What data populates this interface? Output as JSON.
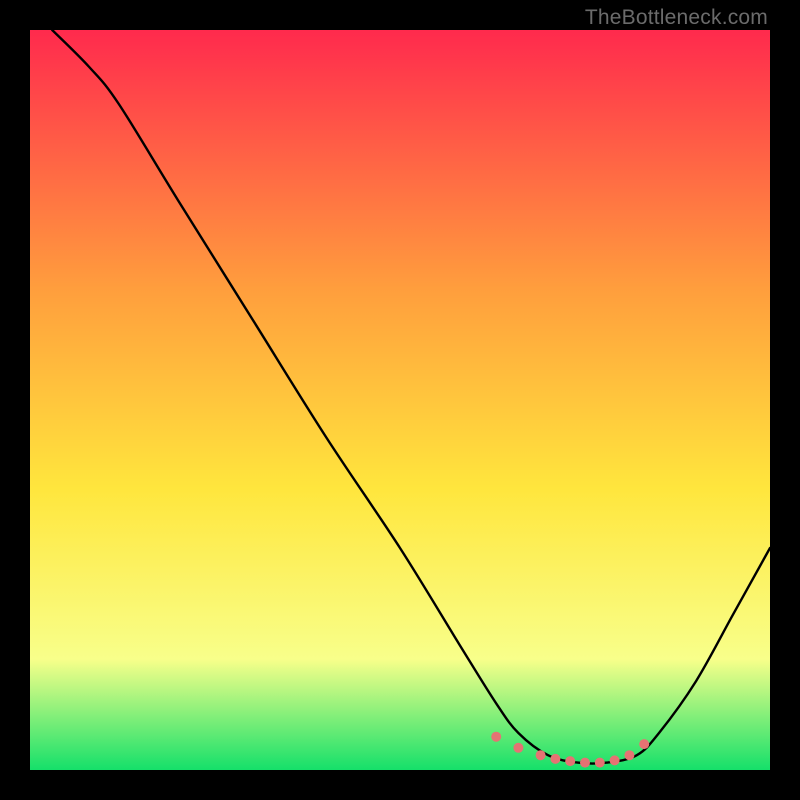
{
  "watermark": "TheBottleneck.com",
  "chart_data": {
    "type": "line",
    "title": "",
    "xlabel": "",
    "ylabel": "",
    "xlim": [
      0,
      100
    ],
    "ylim": [
      0,
      100
    ],
    "grid": false,
    "legend": false,
    "background_gradient": {
      "top": "#ff2a4d",
      "mid_upper": "#ff9e3d",
      "mid": "#ffe63d",
      "mid_lower": "#f8ff8a",
      "bottom": "#15e06a"
    },
    "series": [
      {
        "name": "curve",
        "color": "#000000",
        "x": [
          3,
          8,
          12,
          20,
          30,
          40,
          50,
          58,
          63,
          66,
          70,
          74,
          78,
          82,
          85,
          90,
          95,
          100
        ],
        "y": [
          100,
          95,
          90,
          77,
          61,
          45,
          30,
          17,
          9,
          5,
          2,
          1,
          1,
          2,
          5,
          12,
          21,
          30
        ]
      },
      {
        "name": "minimum-dots",
        "color": "#e57373",
        "type": "scatter",
        "x": [
          63,
          66,
          69,
          71,
          73,
          75,
          77,
          79,
          81,
          83
        ],
        "y": [
          4.5,
          3.0,
          2.0,
          1.5,
          1.2,
          1.0,
          1.0,
          1.3,
          2.0,
          3.5
        ]
      }
    ]
  }
}
